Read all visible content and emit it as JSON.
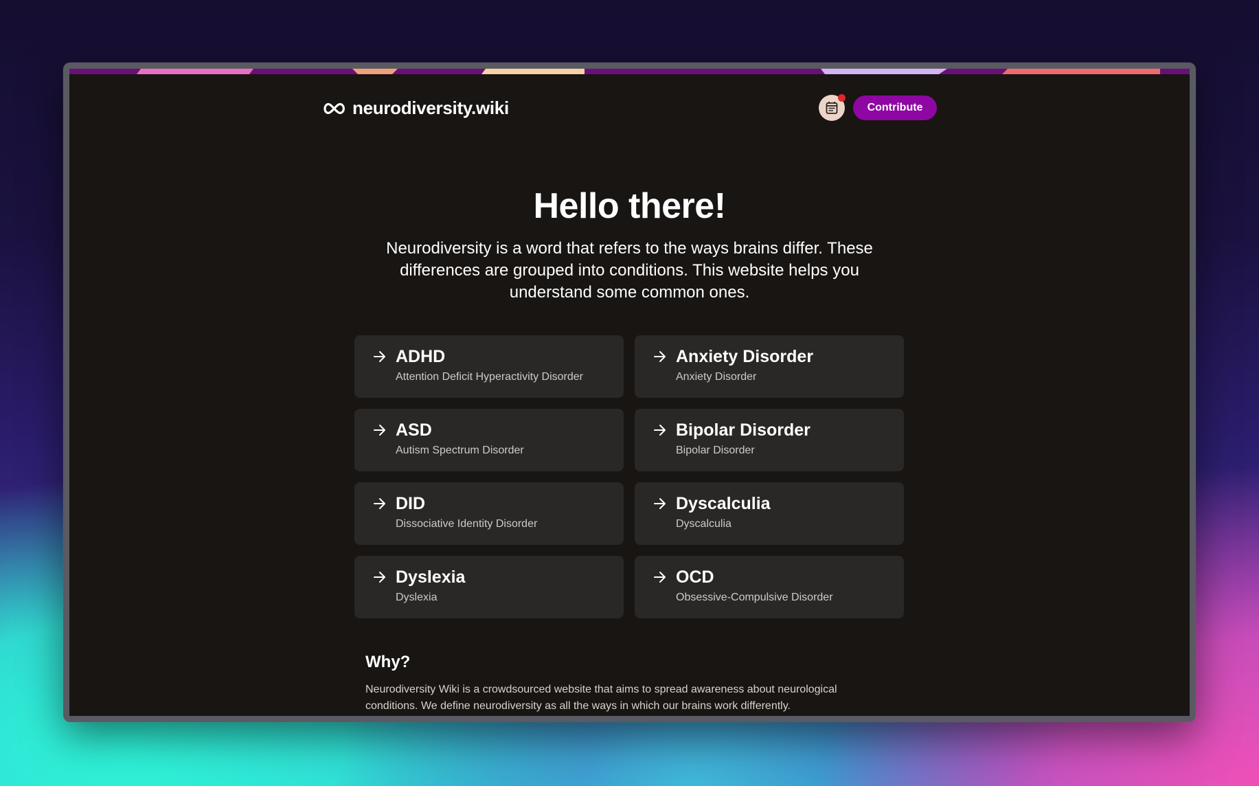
{
  "colors": {
    "accent": "#8f07a3",
    "surface": "#181513",
    "card": "#2a2826",
    "notification_dot": "#e2262b"
  },
  "header": {
    "logo_icon": "infinity-icon",
    "site_name": "neurodiversity.wiki",
    "notes_icon": "notes-icon",
    "contribute_label": "Contribute"
  },
  "hero": {
    "title": "Hello there!",
    "subtitle": "Neurodiversity is a word that refers to the ways brains differ. These differences are grouped into conditions. This website helps you understand some common ones."
  },
  "conditions": [
    {
      "title": "ADHD",
      "description": "Attention Deficit Hyperactivity Disorder"
    },
    {
      "title": "Anxiety Disorder",
      "description": "Anxiety Disorder"
    },
    {
      "title": "ASD",
      "description": "Autism Spectrum Disorder"
    },
    {
      "title": "Bipolar Disorder",
      "description": "Bipolar Disorder"
    },
    {
      "title": "DID",
      "description": "Dissociative Identity Disorder"
    },
    {
      "title": "Dyscalculia",
      "description": "Dyscalculia"
    },
    {
      "title": "Dyslexia",
      "description": "Dyslexia"
    },
    {
      "title": "OCD",
      "description": "Obsessive-Compulsive Disorder"
    }
  ],
  "why": {
    "title": "Why?",
    "text": "Neurodiversity Wiki is a crowdsourced website that aims to spread awareness about neurological conditions. We define neurodiversity as all the ways in which our brains work differently."
  }
}
